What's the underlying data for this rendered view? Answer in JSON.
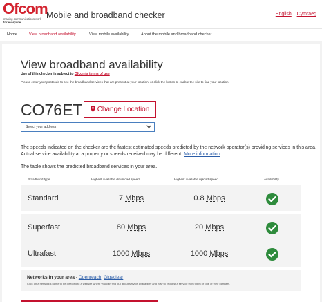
{
  "header": {
    "logo_text": "Ofcom",
    "logo_tagline1": "making communications work",
    "logo_tagline2": "for everyone",
    "title": "Mobile and broadband checker",
    "lang_english": "English",
    "lang_separator": "|",
    "lang_welsh": "Cymraeg"
  },
  "nav": {
    "items": [
      {
        "label": "Home"
      },
      {
        "label": "View broadband availability",
        "active": true
      },
      {
        "label": "View mobile availability"
      },
      {
        "label": "About the mobile and broadband checker"
      }
    ]
  },
  "main": {
    "heading": "View broadband availability",
    "terms_prefix": "Use of this checker is subject to ",
    "terms_link": "Ofcom's terms of use",
    "intro": "Please enter your postcode to see the broadband services that are present at your location, or click the button to enable the site to find your location",
    "postcode": "CO76ET",
    "change_location_label": "Change Location",
    "address_select_value": "Select your address",
    "speed_note": "The speeds indicated on the checker are the fastest estimated speeds predicted by the network operator(s) providing services in this area. Actual service availability at a property or speeds received may be different.",
    "more_info_link": "More information",
    "table_note": "The table shows the predicted broadband services in your area."
  },
  "table": {
    "headers": [
      "Broadband type",
      "Highest available download speed",
      "Highest available upload speed",
      "Availability"
    ],
    "rows": [
      {
        "type": "Standard",
        "download_value": "7",
        "download_unit": "Mbps",
        "upload_value": "0.8",
        "upload_unit": "Mbps",
        "available": true
      },
      {
        "type": "Superfast",
        "download_value": "80",
        "download_unit": "Mbps",
        "upload_value": "20",
        "upload_unit": "Mbps",
        "available": true
      },
      {
        "type": "Ultrafast",
        "download_value": "1000",
        "download_unit": "Mbps",
        "upload_value": "1000",
        "upload_unit": "Mbps",
        "available": true
      }
    ]
  },
  "networks": {
    "title": "Networks in your area",
    "dash": " - ",
    "links": [
      "Openreach",
      "Gigaclear"
    ],
    "separator": ", ",
    "description": "Click on a network's name to be directed to a website where you can find out about service availability and how to request a service from them or one of their partners."
  },
  "colors": {
    "brand": "#c4122f",
    "link": "#2b5da8",
    "check": "#2e8b3c"
  }
}
